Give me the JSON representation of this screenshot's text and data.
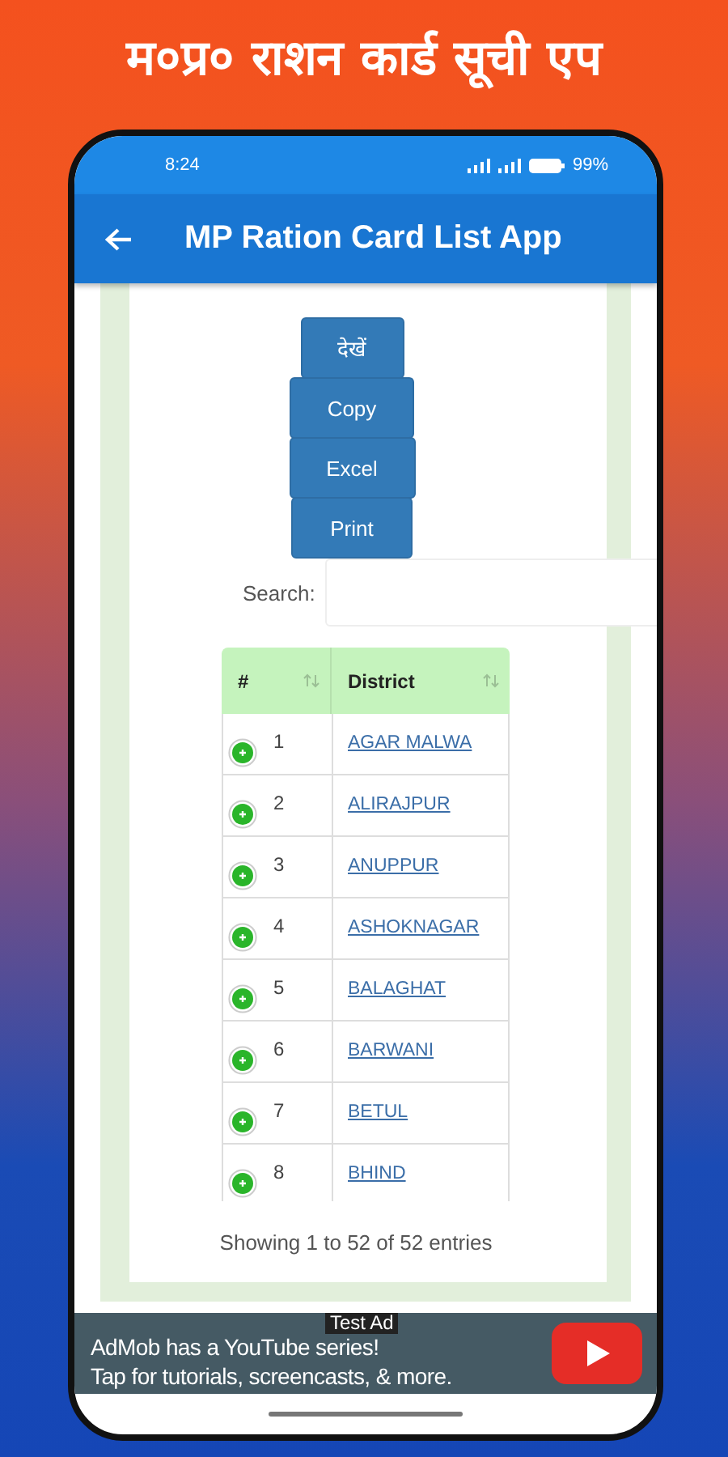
{
  "banner_title": "म०प्र० राशन कार्ड सूची एप",
  "status_bar": {
    "time": "8:24",
    "battery": "99%"
  },
  "app_bar": {
    "title": "MP Ration Card List App"
  },
  "buttons": [
    "देखें",
    "Copy",
    "Excel",
    "Print"
  ],
  "search": {
    "label": "Search:"
  },
  "table": {
    "columns": [
      "#",
      "District"
    ],
    "rows": [
      {
        "number": "1",
        "district": "AGAR MALWA"
      },
      {
        "number": "2",
        "district": "ALIRAJPUR"
      },
      {
        "number": "3",
        "district": "ANUPPUR"
      },
      {
        "number": "4",
        "district": "ASHOKNAGAR"
      },
      {
        "number": "5",
        "district": "BALAGHAT"
      },
      {
        "number": "6",
        "district": "BARWANI"
      },
      {
        "number": "7",
        "district": "BETUL"
      },
      {
        "number": "8",
        "district": "BHIND"
      }
    ]
  },
  "info": "Showing 1 to 52 of 52 entries",
  "ad": {
    "badge": "Test Ad",
    "lines": [
      "AdMob has a YouTube series!",
      "Tap for tutorials, screencasts, & more."
    ]
  }
}
